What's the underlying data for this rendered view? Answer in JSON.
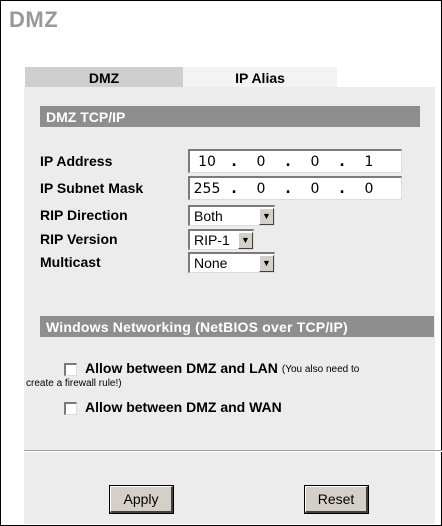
{
  "page": {
    "title": "DMZ"
  },
  "tabs": [
    {
      "label": "DMZ",
      "active": true
    },
    {
      "label": "IP Alias",
      "active": false
    }
  ],
  "tcpip": {
    "section_title": "DMZ TCP/IP",
    "ip_address": {
      "label": "IP Address",
      "octets": [
        "10",
        "0",
        "0",
        "1"
      ]
    },
    "subnet_mask": {
      "label": "IP Subnet Mask",
      "octets": [
        "255",
        "0",
        "0",
        "0"
      ]
    },
    "rip_direction": {
      "label": "RIP Direction",
      "value": "Both"
    },
    "rip_version": {
      "label": "RIP Version",
      "value": "RIP-1"
    },
    "multicast": {
      "label": "Multicast",
      "value": "None"
    }
  },
  "netbios": {
    "section_title": "Windows Networking (NetBIOS over TCP/IP)",
    "allow_lan": {
      "label": "Allow between DMZ and LAN",
      "note_part1": "(You also need to",
      "note_part2": "create a firewall rule!)",
      "checked": false
    },
    "allow_wan": {
      "label": "Allow between DMZ and WAN",
      "checked": false
    }
  },
  "buttons": {
    "apply": "Apply",
    "reset": "Reset"
  },
  "icons": {
    "dropdown": "chevron-down-icon",
    "checkbox": "checkbox-icon"
  }
}
